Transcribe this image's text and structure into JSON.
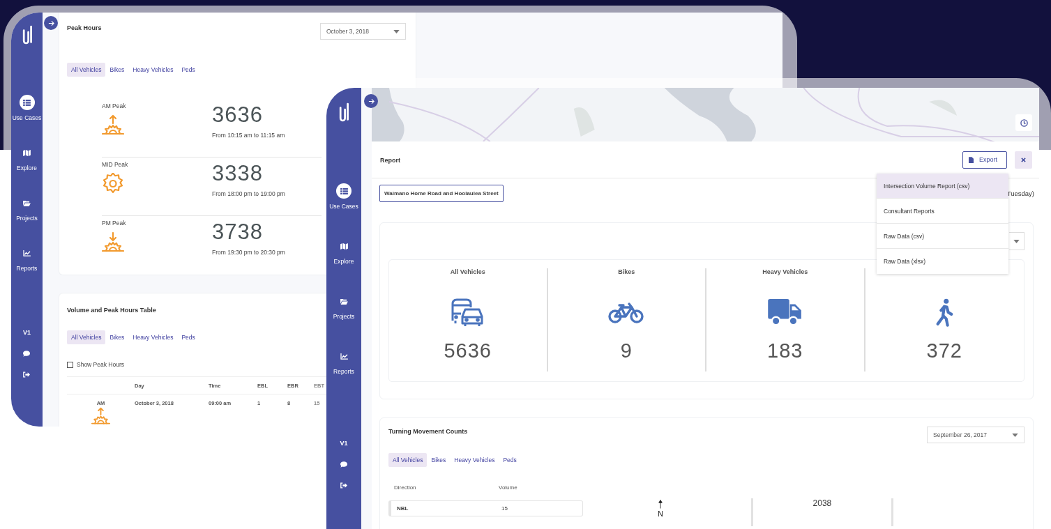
{
  "back_window": {
    "sidebar": {
      "nav_items": [
        {
          "label": "Use Cases",
          "selected": true
        },
        {
          "label": "Explore",
          "selected": false
        },
        {
          "label": "Projects",
          "selected": false
        },
        {
          "label": "Reports",
          "selected": false
        }
      ],
      "version": "V1"
    },
    "peak_hours": {
      "title": "Peak Hours",
      "date": "October 3, 2018",
      "tabs": [
        {
          "label": "All Vehicles",
          "selected": true
        },
        {
          "label": "Bikes",
          "selected": false
        },
        {
          "label": "Heavy Vehicles",
          "selected": false
        },
        {
          "label": "Peds",
          "selected": false
        }
      ],
      "peaks": [
        {
          "label": "AM Peak",
          "kind": "rise",
          "value": "3636",
          "range": "From 10:15 am to 11:15 am"
        },
        {
          "label": "MID Peak",
          "kind": "noon",
          "value": "3338",
          "range": "From 18:00 pm to 19:00 pm"
        },
        {
          "label": "PM Peak",
          "kind": "set",
          "value": "3738",
          "range": "From 19:30 pm to 20:30 pm"
        }
      ]
    },
    "volume_table": {
      "title": "Volume and Peak Hours Table",
      "tabs": [
        {
          "label": "All Vehicles",
          "selected": true
        },
        {
          "label": "Bikes",
          "selected": false
        },
        {
          "label": "Heavy Vehicles",
          "selected": false
        },
        {
          "label": "Peds",
          "selected": false
        }
      ],
      "show_peak_hours": {
        "label": "Show Peak Hours",
        "checked": false
      },
      "columns": [
        "Day",
        "Time",
        "EBL",
        "EBR",
        "EBT"
      ],
      "rows": [
        {
          "period": "AM",
          "kind": "rise",
          "cells": [
            "October 3, 2018",
            "09:00 am",
            "1",
            "8",
            "15"
          ]
        }
      ]
    }
  },
  "front_window": {
    "sidebar": {
      "nav_items": [
        {
          "label": "Use Cases",
          "selected": true
        },
        {
          "label": "Explore",
          "selected": false
        },
        {
          "label": "Projects",
          "selected": false
        },
        {
          "label": "Reports",
          "selected": false
        }
      ],
      "version": "V1"
    },
    "report": {
      "title": "Report",
      "export_label": "Export",
      "location": "Waimano Home Road and Hoolaulea Street",
      "date_fragment": "Tuesday)",
      "export_menu": [
        {
          "label": "Intersection Volume Report (csv)",
          "selected": true
        },
        {
          "label": "Consultant Reports",
          "selected": false
        },
        {
          "label": "Raw Data (csv)",
          "selected": false
        },
        {
          "label": "Raw Data (xlsx)",
          "selected": false
        }
      ],
      "totals": [
        {
          "label": "All Vehicles",
          "value": "5636"
        },
        {
          "label": "Bikes",
          "value": "9"
        },
        {
          "label": "Heavy Vehicles",
          "value": "183"
        },
        {
          "value": "372"
        }
      ],
      "turning_movements": {
        "title": "Turning Movement Counts",
        "date": "September 26, 2017",
        "tabs": [
          {
            "label": "All Vehicles",
            "selected": true
          },
          {
            "label": "Bikes",
            "selected": false
          },
          {
            "label": "Heavy Vehicles",
            "selected": false
          },
          {
            "label": "Peds",
            "selected": false
          }
        ],
        "columns": [
          "Direction",
          "Volume"
        ],
        "rows": [
          {
            "direction": "NBL",
            "volume": "15"
          }
        ],
        "north_label": "N",
        "approach_total": "2038"
      }
    }
  }
}
